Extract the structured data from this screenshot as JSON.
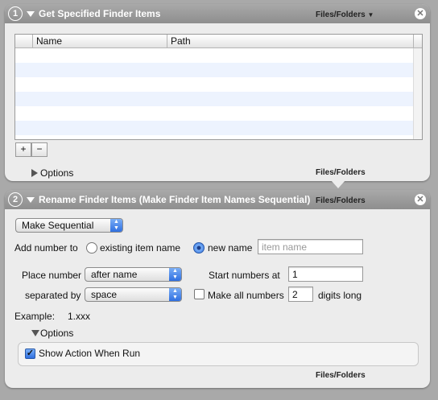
{
  "actions": [
    {
      "number": "1",
      "title": "Get Specified Finder Items",
      "type_tag": "Files/Folders",
      "columns": [
        "Name",
        "Path"
      ],
      "add_label": "+",
      "remove_label": "−",
      "options_label": "Options",
      "output_tag": "Files/Folders"
    },
    {
      "number": "2",
      "title": "Rename Finder Items (Make Finder Item Names Sequential)",
      "type_tag": "Files/Folders",
      "mode_popup": "Make Sequential",
      "add_number_to_label": "Add number to",
      "existing_name_label": "existing item name",
      "new_name_label": "new name",
      "new_name_placeholder": "item name",
      "new_name_selected": true,
      "place_number_label": "Place number",
      "place_number_value": "after name",
      "separated_by_label": "separated by",
      "separated_by_value": "space",
      "start_numbers_label": "Start numbers at",
      "start_numbers_value": "1",
      "make_all_numbers_label": "Make all numbers",
      "make_all_numbers_checked": false,
      "digits_value": "2",
      "digits_long_label": "digits long",
      "example_label": "Example:",
      "example_value": "1.xxx",
      "options_label": "Options",
      "show_action_label": "Show Action When Run",
      "show_action_checked": true,
      "output_tag": "Files/Folders"
    }
  ],
  "colors": {
    "header_gray": "#8e8e8e",
    "panel": "#ececec",
    "table_alt_row": "#edf3fe",
    "accent_blue": "#2f6fe0"
  }
}
